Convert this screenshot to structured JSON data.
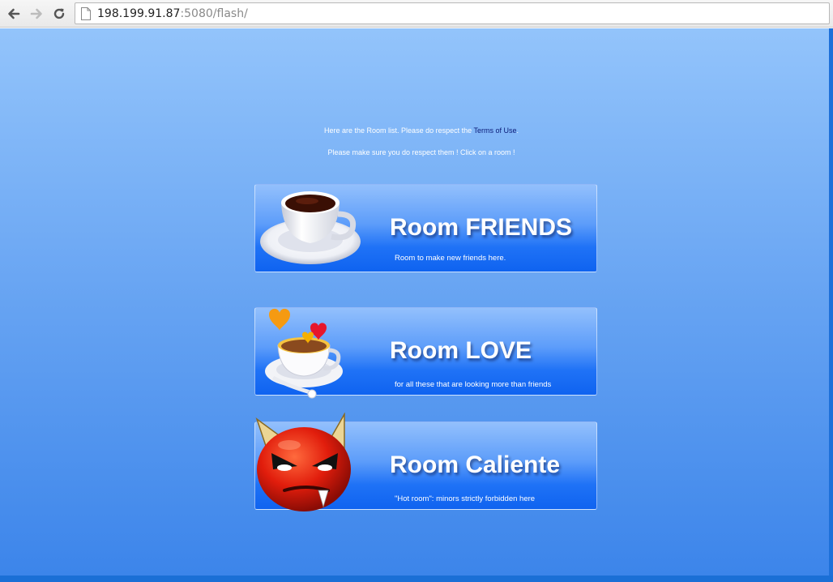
{
  "browser": {
    "url_host": "198.199.91.87",
    "url_rest": ":5080/flash/"
  },
  "intro": {
    "line1_text": "Here are the Room list. Please do respect the ",
    "line1_link": "Terms of Use",
    "line1_end": ".",
    "line2": "Please make sure you do respect them ! Click on a room !"
  },
  "rooms": [
    {
      "title": "Room FRIENDS",
      "description": "Room to make new friends here.",
      "icon": "coffee-cup-icon"
    },
    {
      "title": "Room LOVE",
      "description": "for all these that are looking more than friends",
      "icon": "cup-with-hearts-icon"
    },
    {
      "title": "Room Caliente",
      "description": "\"Hot room\": minors strictly forbidden here",
      "icon": "red-devil-icon"
    }
  ]
}
